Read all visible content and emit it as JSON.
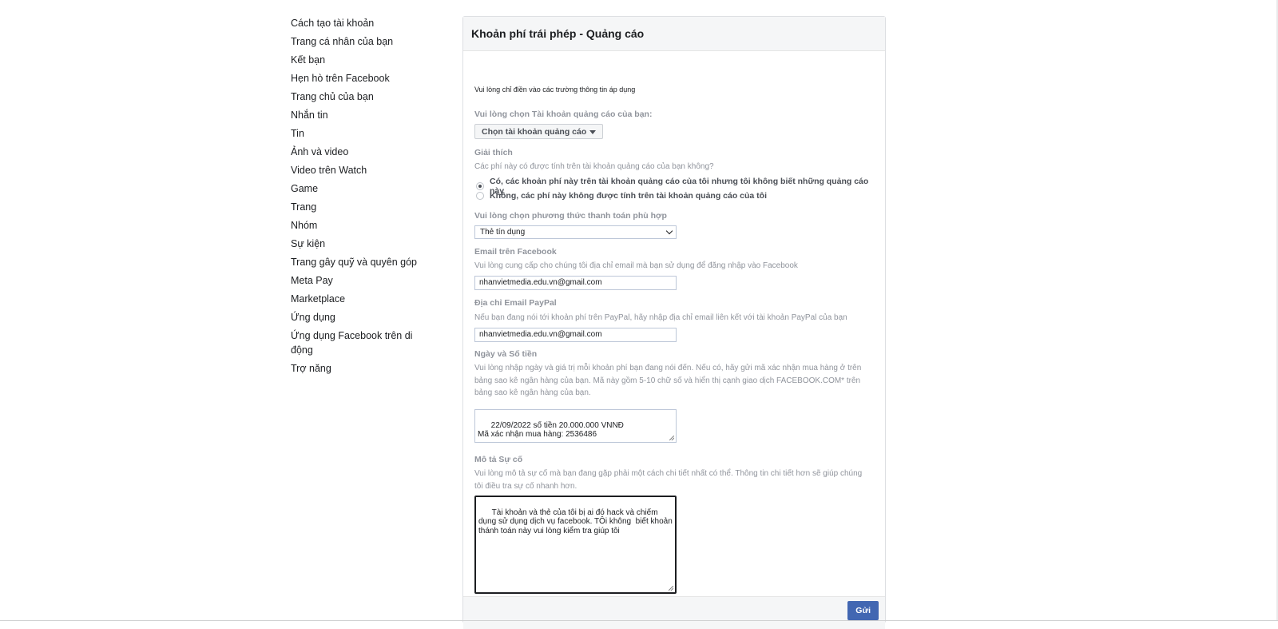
{
  "sidebar": {
    "items": [
      "Cách tạo tài khoản",
      "Trang cá nhân của bạn",
      "Kết bạn",
      "Hẹn hò trên Facebook",
      "Trang chủ của bạn",
      "Nhắn tin",
      "Tin",
      "Ảnh và video",
      "Video trên Watch",
      "Game",
      "Trang",
      "Nhóm",
      "Sự kiện",
      "Trang gây quỹ và quyên góp",
      "Meta Pay",
      "Marketplace",
      "Ứng dụng",
      "Ứng dụng Facebook trên di động",
      "Trợ năng"
    ]
  },
  "form": {
    "title": "Khoản phí trái phép - Quảng cáo",
    "intro": "Vui lòng chỉ điền vào các trường thông tin áp dụng",
    "ad_account": {
      "label": "Vui lòng chọn Tài khoản quảng cáo của bạn:",
      "button": "Chọn tài khoản quảng cáo"
    },
    "explain": {
      "label": "Giải thích",
      "question": "Các phí này có được tính trên tài khoản quảng cáo của bạn không?",
      "option_yes": "Có, các khoản phí này trên tài khoản quảng cáo của tôi nhưng tôi không biết những quảng cáo này",
      "option_no": "Không, các phí này không được tính trên tài khoản quảng cáo của tôi",
      "selected": "yes"
    },
    "payment": {
      "label": "Vui lòng chọn phương thức thanh toán phù hợp",
      "value": "Thẻ tín dụng"
    },
    "fb_email": {
      "label": "Email trên Facebook",
      "desc": "Vui lòng cung cấp cho chúng tôi địa chỉ email mà bạn sử dụng để đăng nhập vào Facebook",
      "value": "nhanvietmedia.edu.vn@gmail.com"
    },
    "paypal_email": {
      "label": "Địa chỉ Email PayPal",
      "desc": "Nếu bạn đang nói tới khoản phí trên PayPal, hãy nhập địa chỉ email liên kết với tài khoản PayPal của bạn",
      "value": "nhanvietmedia.edu.vn@gmail.com"
    },
    "date_amount": {
      "label": "Ngày và Số tiền",
      "desc": "Vui lòng nhập ngày và giá trị mỗi khoản phí bạn đang nói đến. Nếu có, hãy gửi mã xác nhận mua hàng ở trên bảng sao kê ngân hàng của bạn. Mã này gồm 5-10 chữ số và hiển thị cạnh giao dịch FACEBOOK.COM* trên bảng sao kê ngân hàng của bạn.",
      "value": "22/09/2022 số tiền 20.000.000 VNNĐ\nMã xác nhận mua hàng: 2536486"
    },
    "incident": {
      "label": "Mô tả Sự cố",
      "desc": "Vui lòng mô tả sự cố mà bạn đang gặp phải một cách chi tiết nhất có thể. Thông tin chi tiết hơn sẽ giúp chúng tôi điều tra sự cố nhanh hơn.",
      "value": "Tài khoản và thẻ của tôi bị ai đó hack và chiếm dụng sử dụng dịch vụ facebook. TÔi không  biết khoản thánh toán này vui lòng kiểm tra giúp tôi"
    },
    "submit": "Gửi"
  }
}
